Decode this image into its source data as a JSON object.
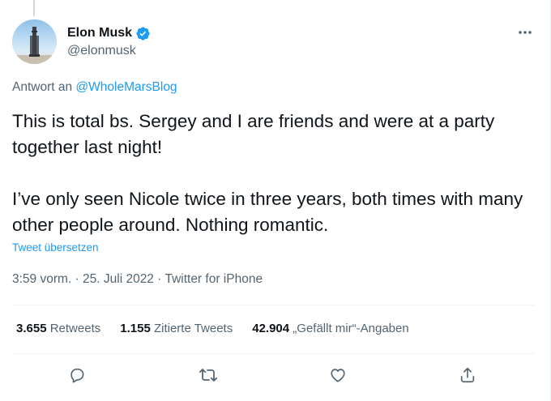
{
  "author": {
    "name": "Elon Musk",
    "handle": "@elonmusk",
    "verified": true
  },
  "reply": {
    "prefix": "Antwort an",
    "mention": "@WholeMarsBlog"
  },
  "tweet": {
    "paragraphs": [
      "This is total bs. Sergey and I are friends and were at a party together last night!",
      "I’ve only seen Nicole twice in three years, both times with many other people around. Nothing romantic."
    ],
    "translate_label": "Tweet übersetzen"
  },
  "meta": {
    "time": "3:59 vorm.",
    "date": "25. Juli 2022",
    "separator": "·",
    "source": "Twitter for iPhone"
  },
  "stats": {
    "retweets": {
      "count": "3.655",
      "label": "Retweets"
    },
    "quotes": {
      "count": "1.155",
      "label": "Zitierte Tweets"
    },
    "likes": {
      "count": "42.904",
      "label": "„Gefällt mir“-Angaben"
    }
  },
  "actions": [
    "reply-icon",
    "retweet-icon",
    "like-icon",
    "share-icon"
  ],
  "colors": {
    "accent": "#1d9bf0",
    "text": "#0f1419",
    "secondary": "#536471",
    "divider": "#eff3f4"
  }
}
